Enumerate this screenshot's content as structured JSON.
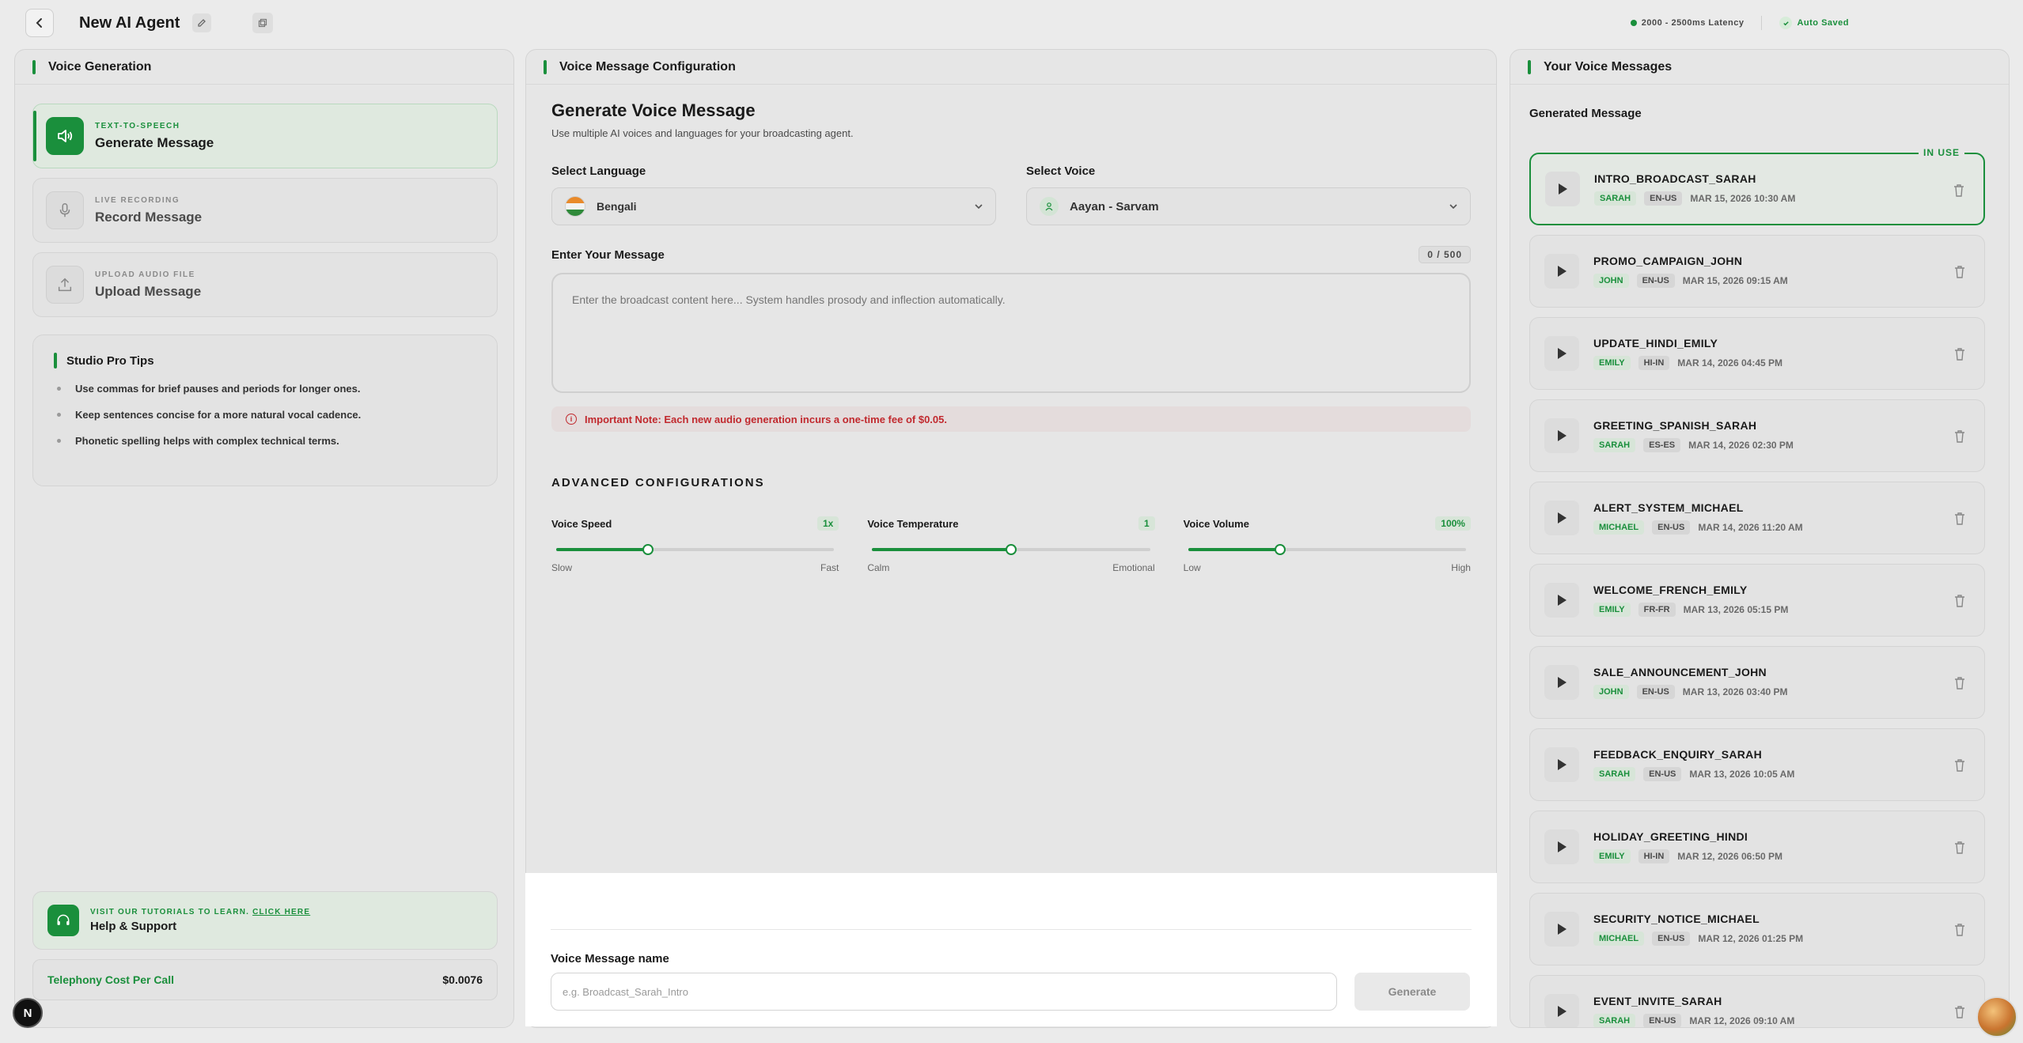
{
  "topbar": {
    "title": "New AI Agent",
    "latency": "2000 - 2500ms Latency",
    "autosave": "Auto Saved"
  },
  "left": {
    "header": "Voice Generation",
    "methods": [
      {
        "sub": "TEXT-TO-SPEECH",
        "title": "Generate Message",
        "icon": "speaker-icon",
        "active": true
      },
      {
        "sub": "LIVE RECORDING",
        "title": "Record Message",
        "icon": "microphone-icon",
        "active": false
      },
      {
        "sub": "UPLOAD AUDIO FILE",
        "title": "Upload Message",
        "icon": "upload-icon",
        "active": false
      }
    ],
    "tips": {
      "title": "Studio Pro Tips",
      "items": [
        "Use commas for brief pauses and periods for longer ones.",
        "Keep sentences concise for a more natural vocal cadence.",
        "Phonetic spelling helps with complex technical terms."
      ]
    },
    "help": {
      "sub_prefix": "VISIT OUR TUTORIALS TO LEARN.",
      "sub_link": "CLICK HERE",
      "title": "Help & Support"
    },
    "cost": {
      "label": "Telephony Cost Per Call",
      "value": "$0.0076"
    },
    "badge": "N"
  },
  "middle": {
    "header": "Voice Message Configuration",
    "title": "Generate Voice Message",
    "subtitle": "Use multiple AI voices and languages for your broadcasting agent.",
    "language": {
      "label": "Select Language",
      "value": "Bengali"
    },
    "voice": {
      "label": "Select Voice",
      "value": "Aayan - Sarvam"
    },
    "message": {
      "label": "Enter Your Message",
      "counter": "0 / 500",
      "placeholder": "Enter the broadcast content here... System handles prosody and inflection automatically."
    },
    "note": "Important Note: Each new audio generation incurs a one-time fee of $0.05.",
    "advanced": {
      "title": "ADVANCED CONFIGURATIONS",
      "sliders": [
        {
          "label": "Voice Speed",
          "value": "1x",
          "min": "Slow",
          "max": "Fast",
          "fraction": 0.33
        },
        {
          "label": "Voice Temperature",
          "value": "1",
          "min": "Calm",
          "max": "Emotional",
          "fraction": 0.5
        },
        {
          "label": "Voice Volume",
          "value": "100%",
          "min": "Low",
          "max": "High",
          "fraction": 0.33
        }
      ]
    }
  },
  "bottom": {
    "label": "Voice Message name",
    "placeholder": "e.g. Broadcast_Sarah_Intro",
    "button": "Generate"
  },
  "right": {
    "header": "Your Voice Messages",
    "subheader": "Generated Message",
    "in_use": "IN USE",
    "messages": [
      {
        "name": "INTRO_BROADCAST_SARAH",
        "voice": "SARAH",
        "lang": "EN-US",
        "date": "MAR 15, 2026 10:30 AM"
      },
      {
        "name": "PROMO_CAMPAIGN_JOHN",
        "voice": "JOHN",
        "lang": "EN-US",
        "date": "MAR 15, 2026 09:15 AM"
      },
      {
        "name": "UPDATE_HINDI_EMILY",
        "voice": "EMILY",
        "lang": "HI-IN",
        "date": "MAR 14, 2026 04:45 PM"
      },
      {
        "name": "GREETING_SPANISH_SARAH",
        "voice": "SARAH",
        "lang": "ES-ES",
        "date": "MAR 14, 2026 02:30 PM"
      },
      {
        "name": "ALERT_SYSTEM_MICHAEL",
        "voice": "MICHAEL",
        "lang": "EN-US",
        "date": "MAR 14, 2026 11:20 AM"
      },
      {
        "name": "WELCOME_FRENCH_EMILY",
        "voice": "EMILY",
        "lang": "FR-FR",
        "date": "MAR 13, 2026 05:15 PM"
      },
      {
        "name": "SALE_ANNOUNCEMENT_JOHN",
        "voice": "JOHN",
        "lang": "EN-US",
        "date": "MAR 13, 2026 03:40 PM"
      },
      {
        "name": "FEEDBACK_ENQUIRY_SARAH",
        "voice": "SARAH",
        "lang": "EN-US",
        "date": "MAR 13, 2026 10:05 AM"
      },
      {
        "name": "HOLIDAY_GREETING_HINDI",
        "voice": "EMILY",
        "lang": "HI-IN",
        "date": "MAR 12, 2026 06:50 PM"
      },
      {
        "name": "SECURITY_NOTICE_MICHAEL",
        "voice": "MICHAEL",
        "lang": "EN-US",
        "date": "MAR 12, 2026 01:25 PM"
      },
      {
        "name": "EVENT_INVITE_SARAH",
        "voice": "SARAH",
        "lang": "EN-US",
        "date": "MAR 12, 2026 09:10 AM"
      }
    ]
  },
  "colors": {
    "accent": "#1a8f3c",
    "danger": "#c1292e"
  }
}
